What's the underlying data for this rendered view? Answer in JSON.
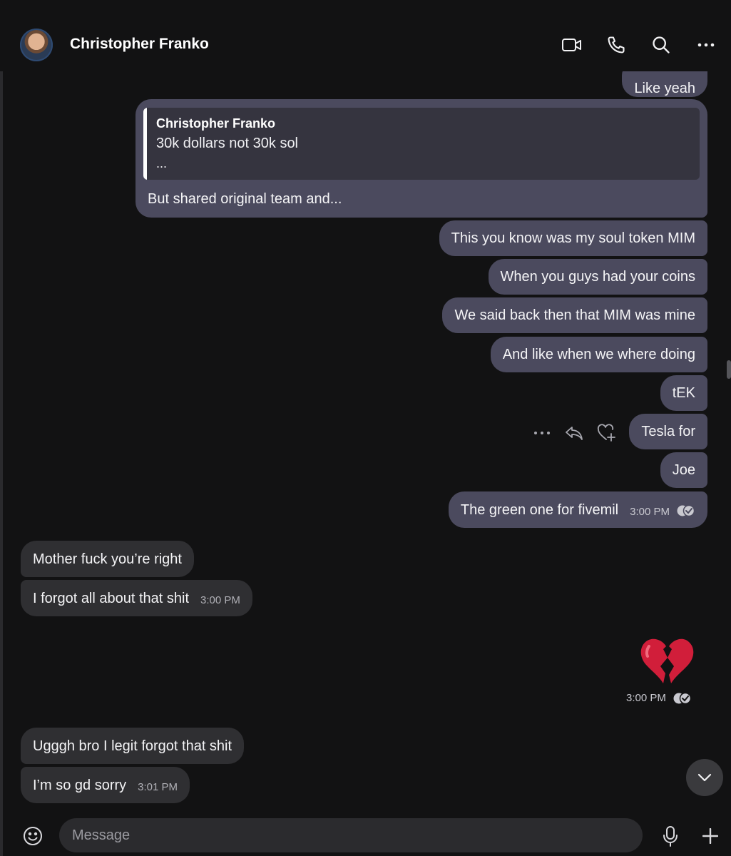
{
  "header": {
    "contact_name": "Christopher Franko",
    "icons": [
      "video-call-icon",
      "phone-icon",
      "search-icon",
      "more-icon"
    ]
  },
  "messages": {
    "out_like_yeah": "Like yeah",
    "quote": {
      "author": "Christopher Franko",
      "text": "30k dollars not 30k sol",
      "ellipsis": "...",
      "reply": "But shared original team and..."
    },
    "out_1": "This you know was my soul token MIM",
    "out_2": "When you guys had your coins",
    "out_3": "We said back then that MIM was mine",
    "out_4": "And like when we where doing",
    "out_5": "tEK",
    "out_6": "Tesla for",
    "out_7": "Joe",
    "out_8": "The green one for fivemil",
    "out_8_time": "3:00 PM",
    "in_1": "Mother fuck you’re right",
    "in_2": "I forgot all about that shit",
    "in_2_time": "3:00 PM",
    "emoji_msg": "broken-heart-emoji",
    "emoji_time": "3:00 PM",
    "in_3": "Ugggh bro I legit forgot that shit",
    "in_4": "I’m so gd sorry",
    "in_4_time": "3:01 PM"
  },
  "hover_actions": [
    "more-icon",
    "reply-icon",
    "react-icon"
  ],
  "composer": {
    "placeholder": "Message"
  },
  "colors": {
    "background": "#121213",
    "outgoing_bubble": "#4b4a5e",
    "incoming_bubble": "#2f2f32"
  }
}
